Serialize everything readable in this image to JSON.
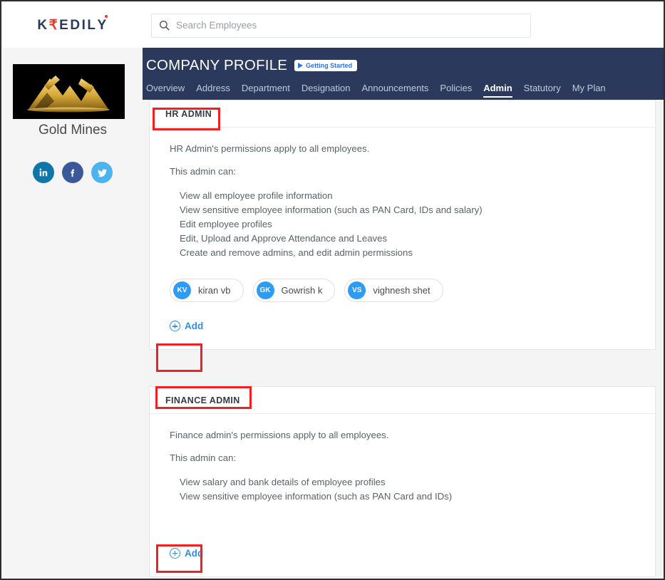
{
  "brand": {
    "part1": "K",
    "rupee": "₹",
    "part2": "EDIL",
    "part3": "Y"
  },
  "search": {
    "placeholder": "Search Employees",
    "value": "",
    "icon": "search-icon"
  },
  "header": {
    "title": "COMPANY PROFILE",
    "getting_started": "Getting Started",
    "tabs": [
      {
        "label": "Overview",
        "active": false
      },
      {
        "label": "Address",
        "active": false
      },
      {
        "label": "Department",
        "active": false
      },
      {
        "label": "Designation",
        "active": false
      },
      {
        "label": "Announcements",
        "active": false
      },
      {
        "label": "Policies",
        "active": false
      },
      {
        "label": "Admin",
        "active": true
      },
      {
        "label": "Statutory",
        "active": false
      },
      {
        "label": "My Plan",
        "active": false
      }
    ]
  },
  "sidebar": {
    "company_name": "Gold Mines",
    "logo_alt": "gold-mines-logo",
    "socials": [
      {
        "name": "linkedin-icon",
        "color": "#0e76a8"
      },
      {
        "name": "facebook-icon",
        "color": "#3b5998"
      },
      {
        "name": "twitter-icon",
        "color": "#4cb3ee"
      }
    ]
  },
  "cards": [
    {
      "title": "HR ADMIN",
      "intro": "HR Admin's permissions apply to all employees.",
      "subhead": "This admin can:",
      "permissions": [
        "View all employee profile information",
        "View sensitive employee information (such as PAN Card, IDs and salary)",
        "Edit employee profiles",
        "Edit, Upload and Approve Attendance and Leaves",
        "Create and remove admins, and edit admin permissions"
      ],
      "members": [
        {
          "initials": "KV",
          "name": "kiran vb"
        },
        {
          "initials": "GK",
          "name": "Gowrish k"
        },
        {
          "initials": "VS",
          "name": "vighnesh shet"
        }
      ],
      "add_label": "Add"
    },
    {
      "title": "FINANCE ADMIN",
      "intro": "Finance admin's permissions apply to all employees.",
      "subhead": "This admin can:",
      "permissions": [
        "View salary and bank details of employee profiles",
        "View sensitive employee information (such as PAN Card and IDs)"
      ],
      "members": [],
      "add_label": "Add"
    }
  ],
  "colors": {
    "nav_bg": "#2b3a5c",
    "accent_link": "#2f8fe8",
    "annotation": "#ee2222",
    "avatar": "#2e9bf4"
  }
}
